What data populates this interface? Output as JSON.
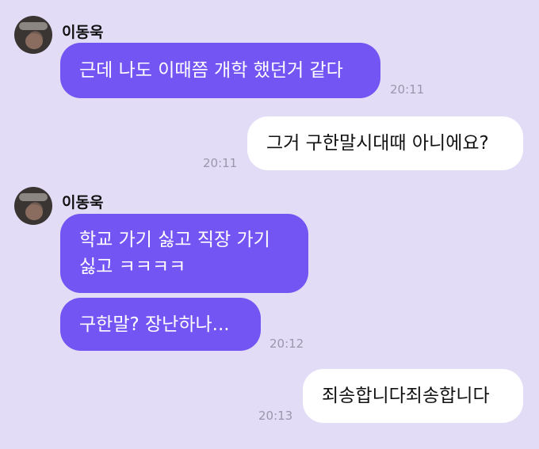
{
  "messages": [
    {
      "sender": "이동욱",
      "text": "근데 나도 이때쯤 개학 했던거 같다",
      "time": "20:11"
    },
    {
      "text": "그거 구한말시대때 아니에요?",
      "time": "20:11"
    },
    {
      "sender": "이동욱",
      "text": "학교 가기 싫고 직장 가기\n싫고 ㅋㅋㅋㅋ"
    },
    {
      "text": "구한말? 장난하나...",
      "time": "20:12"
    },
    {
      "text": "죄송합니다죄송합니다",
      "time": "20:13"
    }
  ]
}
